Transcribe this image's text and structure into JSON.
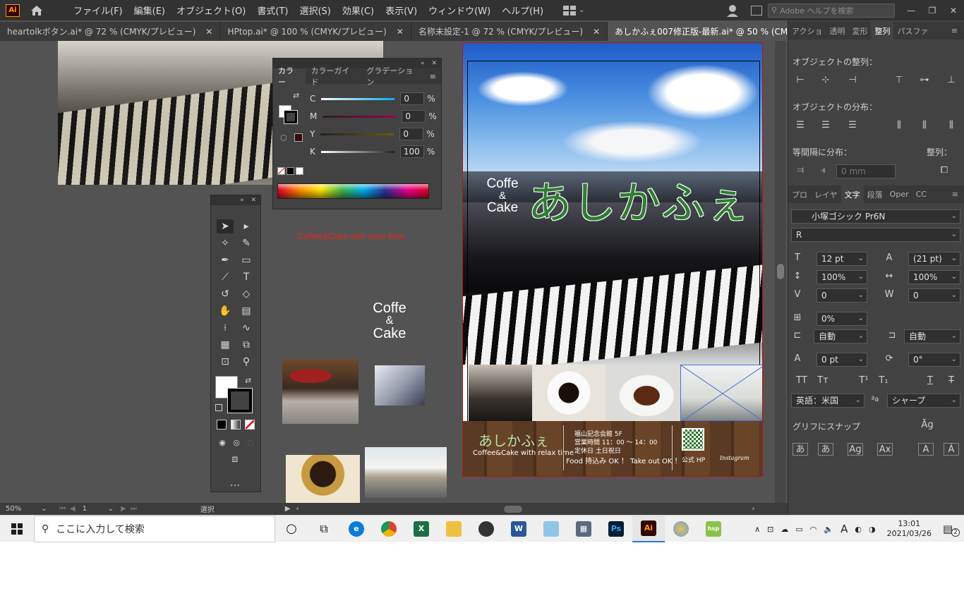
{
  "menubar": {
    "logo": "Ai",
    "items": [
      "ファイル(F)",
      "編集(E)",
      "オブジェクト(O)",
      "書式(T)",
      "選択(S)",
      "効果(C)",
      "表示(V)",
      "ウィンドウ(W)",
      "ヘルプ(H)"
    ],
    "search_placeholder": "Adobe ヘルプを検索"
  },
  "tabs": [
    {
      "label": "heartolkボタン.ai* @ 72 % (CMYK/プレビュー)",
      "active": false
    },
    {
      "label": "HPtop.ai* @ 100 % (CMYK/プレビュー)",
      "active": false
    },
    {
      "label": "名称未設定-1 @ 72 % (CMYK/プレビュー)",
      "active": false
    },
    {
      "label": "あしかふぇ007修正版-最新.ai* @ 50 % (CMYK/プレビュー)",
      "active": true
    }
  ],
  "color_panel": {
    "tabs": [
      "カラー",
      "カラーガイド",
      "グラデーション"
    ],
    "channels": [
      {
        "label": "C",
        "value": "0",
        "unit": "%"
      },
      {
        "label": "M",
        "value": "0",
        "unit": "%"
      },
      {
        "label": "Y",
        "value": "0",
        "unit": "%"
      },
      {
        "label": "K",
        "value": "100",
        "unit": "%"
      }
    ]
  },
  "pasteboard": {
    "tagline": "Coffee&Cake with relax time",
    "logo_line1": "Coffe",
    "logo_line2": "&",
    "logo_line3": "Cake"
  },
  "poster": {
    "logo_line1": "Coffe",
    "logo_line2": "&",
    "logo_line3": "Cake",
    "title": "あしかふぇ",
    "footer_title": "あしかふぇ",
    "footer_tagline": "Coffee&Cake with relax time",
    "address": "福山記念会館 5F",
    "hours": "営業時間 11：00 〜 14：00",
    "holiday": "定休日 土日祝日",
    "food_note": "Food 持込み OK ！ Take out OK ！",
    "hp_label": "公式 HP",
    "instagram_label": "Instagram"
  },
  "right_dock": {
    "top_tabs": [
      "アクショ",
      "透明",
      "変形",
      "整列",
      "パスファ"
    ],
    "align_objects_label": "オブジェクトの整列：",
    "distribute_objects_label": "オブジェクトの分布：",
    "distribute_spacing_label": "等間隔に分布：",
    "align_to_label": "整列：",
    "spacing_value": "0 mm",
    "char_tabs": [
      "プロ",
      "レイヤ",
      "文字",
      "段落",
      "Oper",
      "CC"
    ],
    "font_family": "小塚ゴシック Pr6N",
    "font_style": "R",
    "font_size": "12 pt",
    "leading": "(21 pt)",
    "vscale": "100%",
    "hscale": "100%",
    "kerning": "0",
    "tracking": "0",
    "tsume": "0%",
    "aki_left": "自動",
    "aki_right": "自動",
    "baseline": "0 pt",
    "rotation": "0°",
    "language": "英語：米国",
    "antialias": "シャープ",
    "snap_label": "グリフにスナップ"
  },
  "statusbar": {
    "zoom": "50%",
    "artboard": "1",
    "tool": "選択"
  },
  "taskbar": {
    "search_placeholder": "ここに入力して検索",
    "time": "13:01",
    "date": "2021/03/26",
    "ime": "A",
    "notifications": "2"
  }
}
